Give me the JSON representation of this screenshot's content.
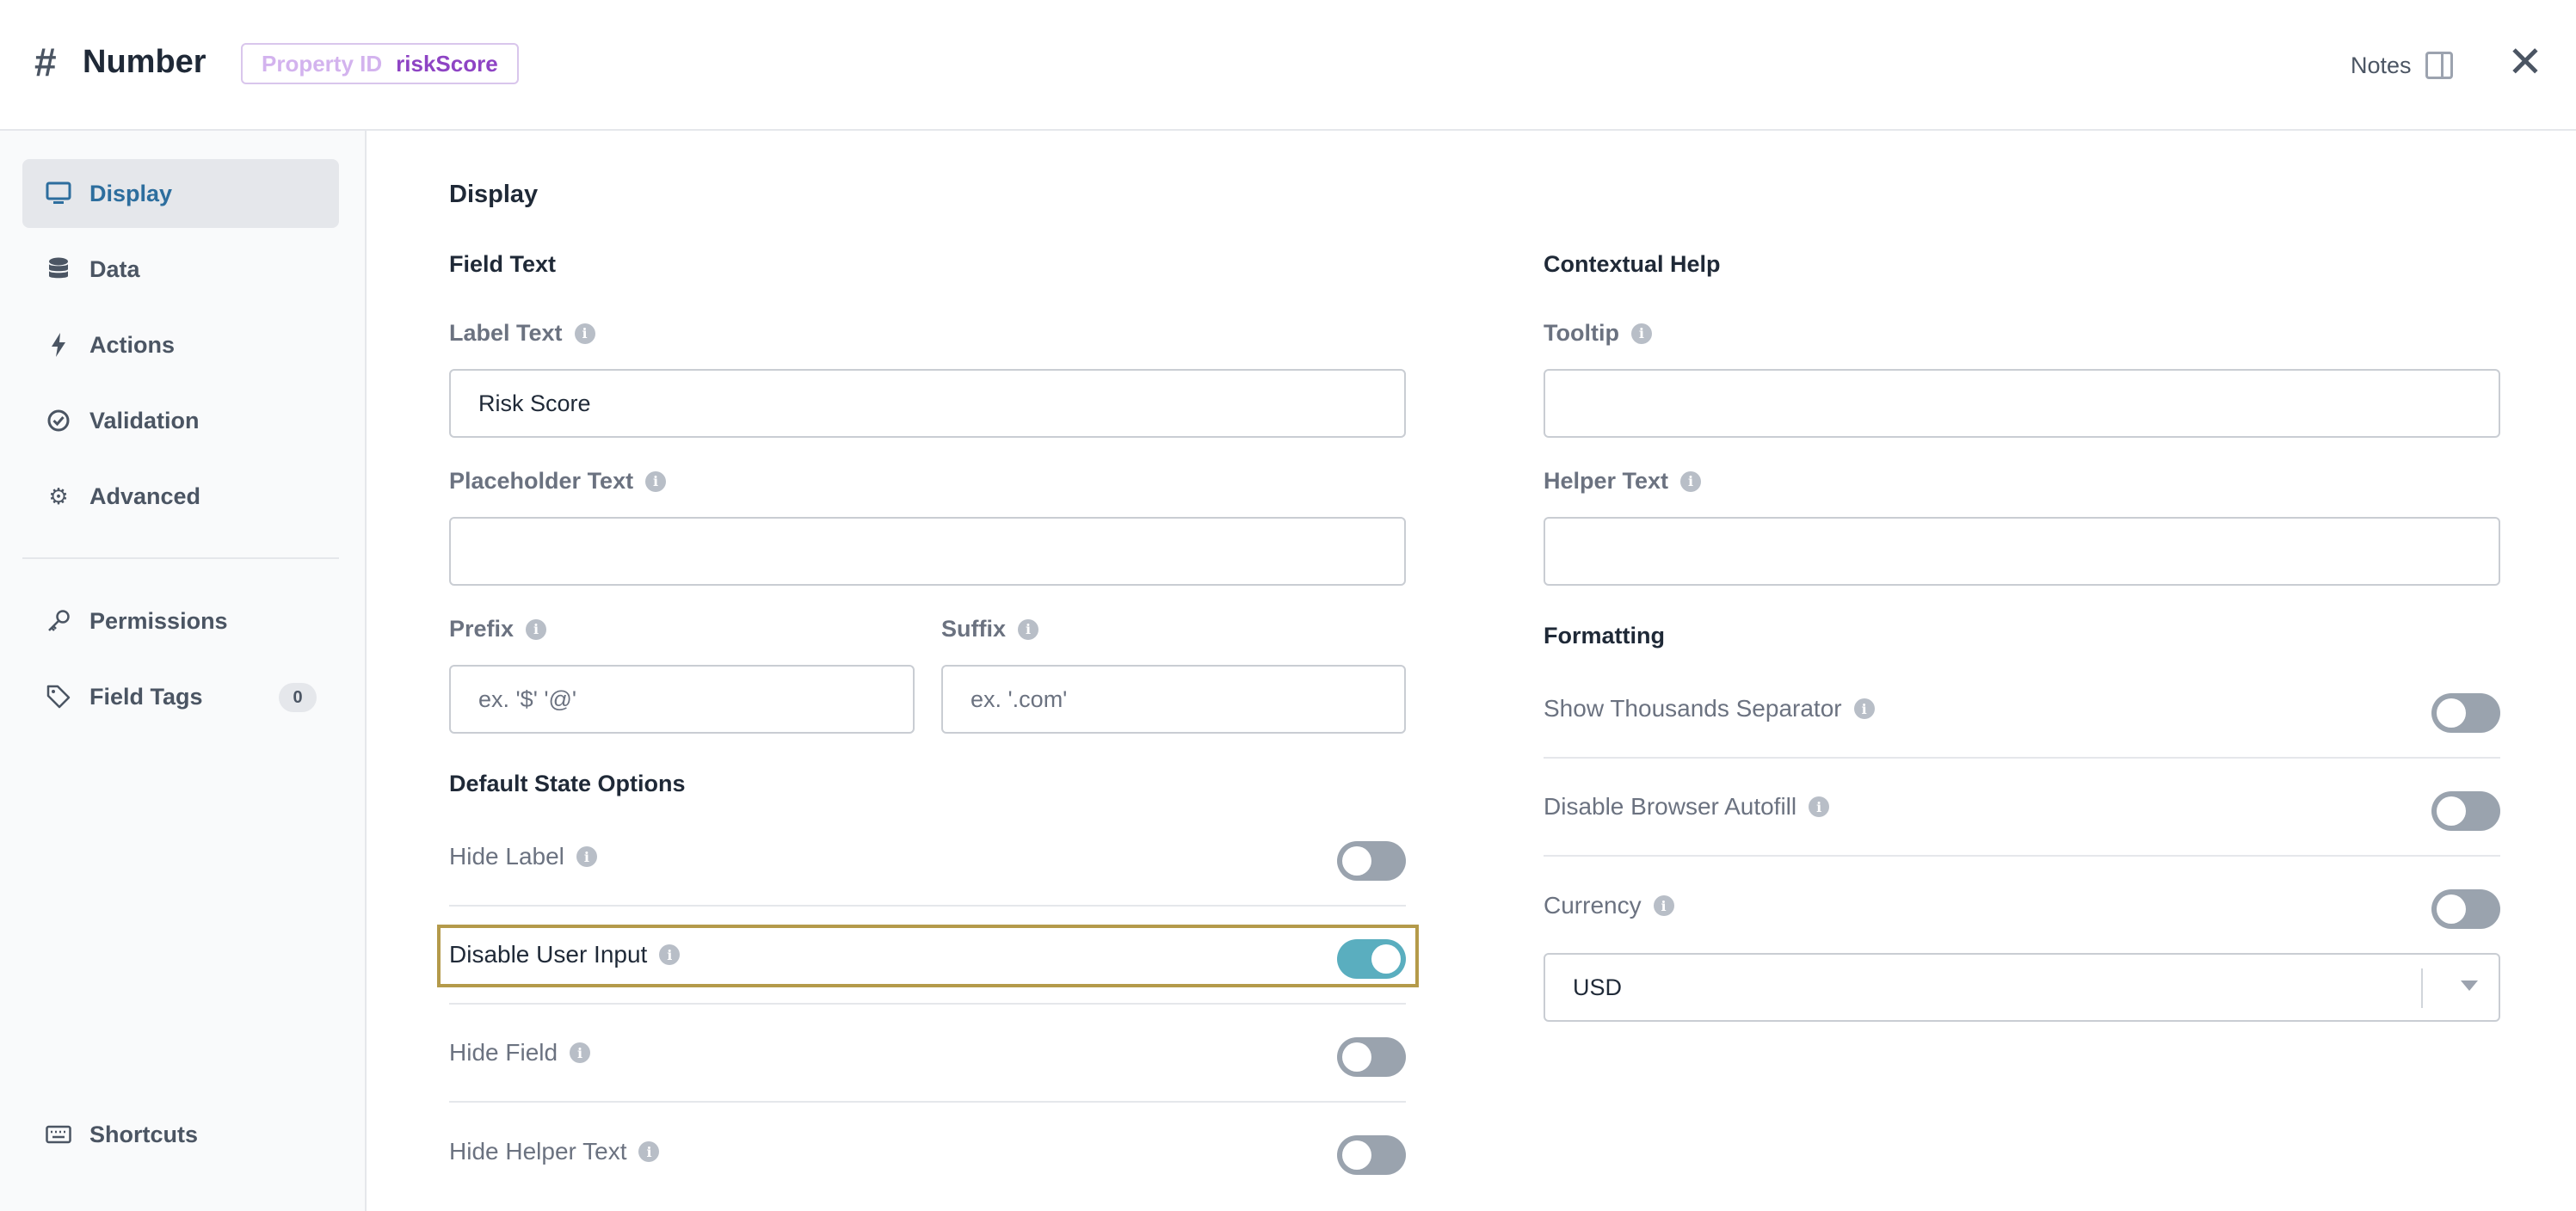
{
  "header": {
    "type_icon": "hash-icon",
    "title": "Number",
    "property_key": "Property ID",
    "property_value": "riskScore",
    "notes_label": "Notes",
    "close_icon": "close-icon"
  },
  "sidebar": {
    "items": [
      {
        "label": "Display",
        "icon": "monitor-icon",
        "active": true
      },
      {
        "label": "Data",
        "icon": "database-icon"
      },
      {
        "label": "Actions",
        "icon": "bolt-icon"
      },
      {
        "label": "Validation",
        "icon": "check-circle-icon"
      },
      {
        "label": "Advanced",
        "icon": "gear-icon"
      }
    ],
    "secondary": [
      {
        "label": "Permissions",
        "icon": "key-icon"
      },
      {
        "label": "Field Tags",
        "icon": "tag-icon",
        "count": "0"
      }
    ],
    "footer": {
      "label": "Shortcuts",
      "icon": "keyboard-icon"
    }
  },
  "main": {
    "section_title": "Display",
    "field_text": {
      "title": "Field Text",
      "label_text": {
        "label": "Label Text",
        "value": "Risk Score"
      },
      "placeholder_text": {
        "label": "Placeholder Text",
        "value": ""
      },
      "prefix": {
        "label": "Prefix",
        "placeholder": "ex. '$' '@'"
      },
      "suffix": {
        "label": "Suffix",
        "placeholder": "ex. '.com'"
      }
    },
    "default_state": {
      "title": "Default State Options",
      "options": [
        {
          "label": "Hide Label",
          "on": false
        },
        {
          "label": "Disable User Input",
          "on": true
        },
        {
          "label": "Hide Field",
          "on": false
        },
        {
          "label": "Hide Helper Text",
          "on": false
        }
      ]
    },
    "contextual_help": {
      "title": "Contextual Help",
      "tooltip": {
        "label": "Tooltip",
        "value": ""
      },
      "helper_text": {
        "label": "Helper Text",
        "value": ""
      }
    },
    "formatting": {
      "title": "Formatting",
      "options": [
        {
          "label": "Show Thousands Separator",
          "on": false
        },
        {
          "label": "Disable Browser Autofill",
          "on": false
        },
        {
          "label": "Currency",
          "on": false
        }
      ],
      "currency_value": "USD"
    }
  },
  "colors": {
    "accent": "#2d6e9e",
    "toggle_on": "#5aaebf",
    "toggle_off": "#9aa3ae",
    "highlight": "#b49a4a",
    "badge_value": "#8e44c4"
  }
}
